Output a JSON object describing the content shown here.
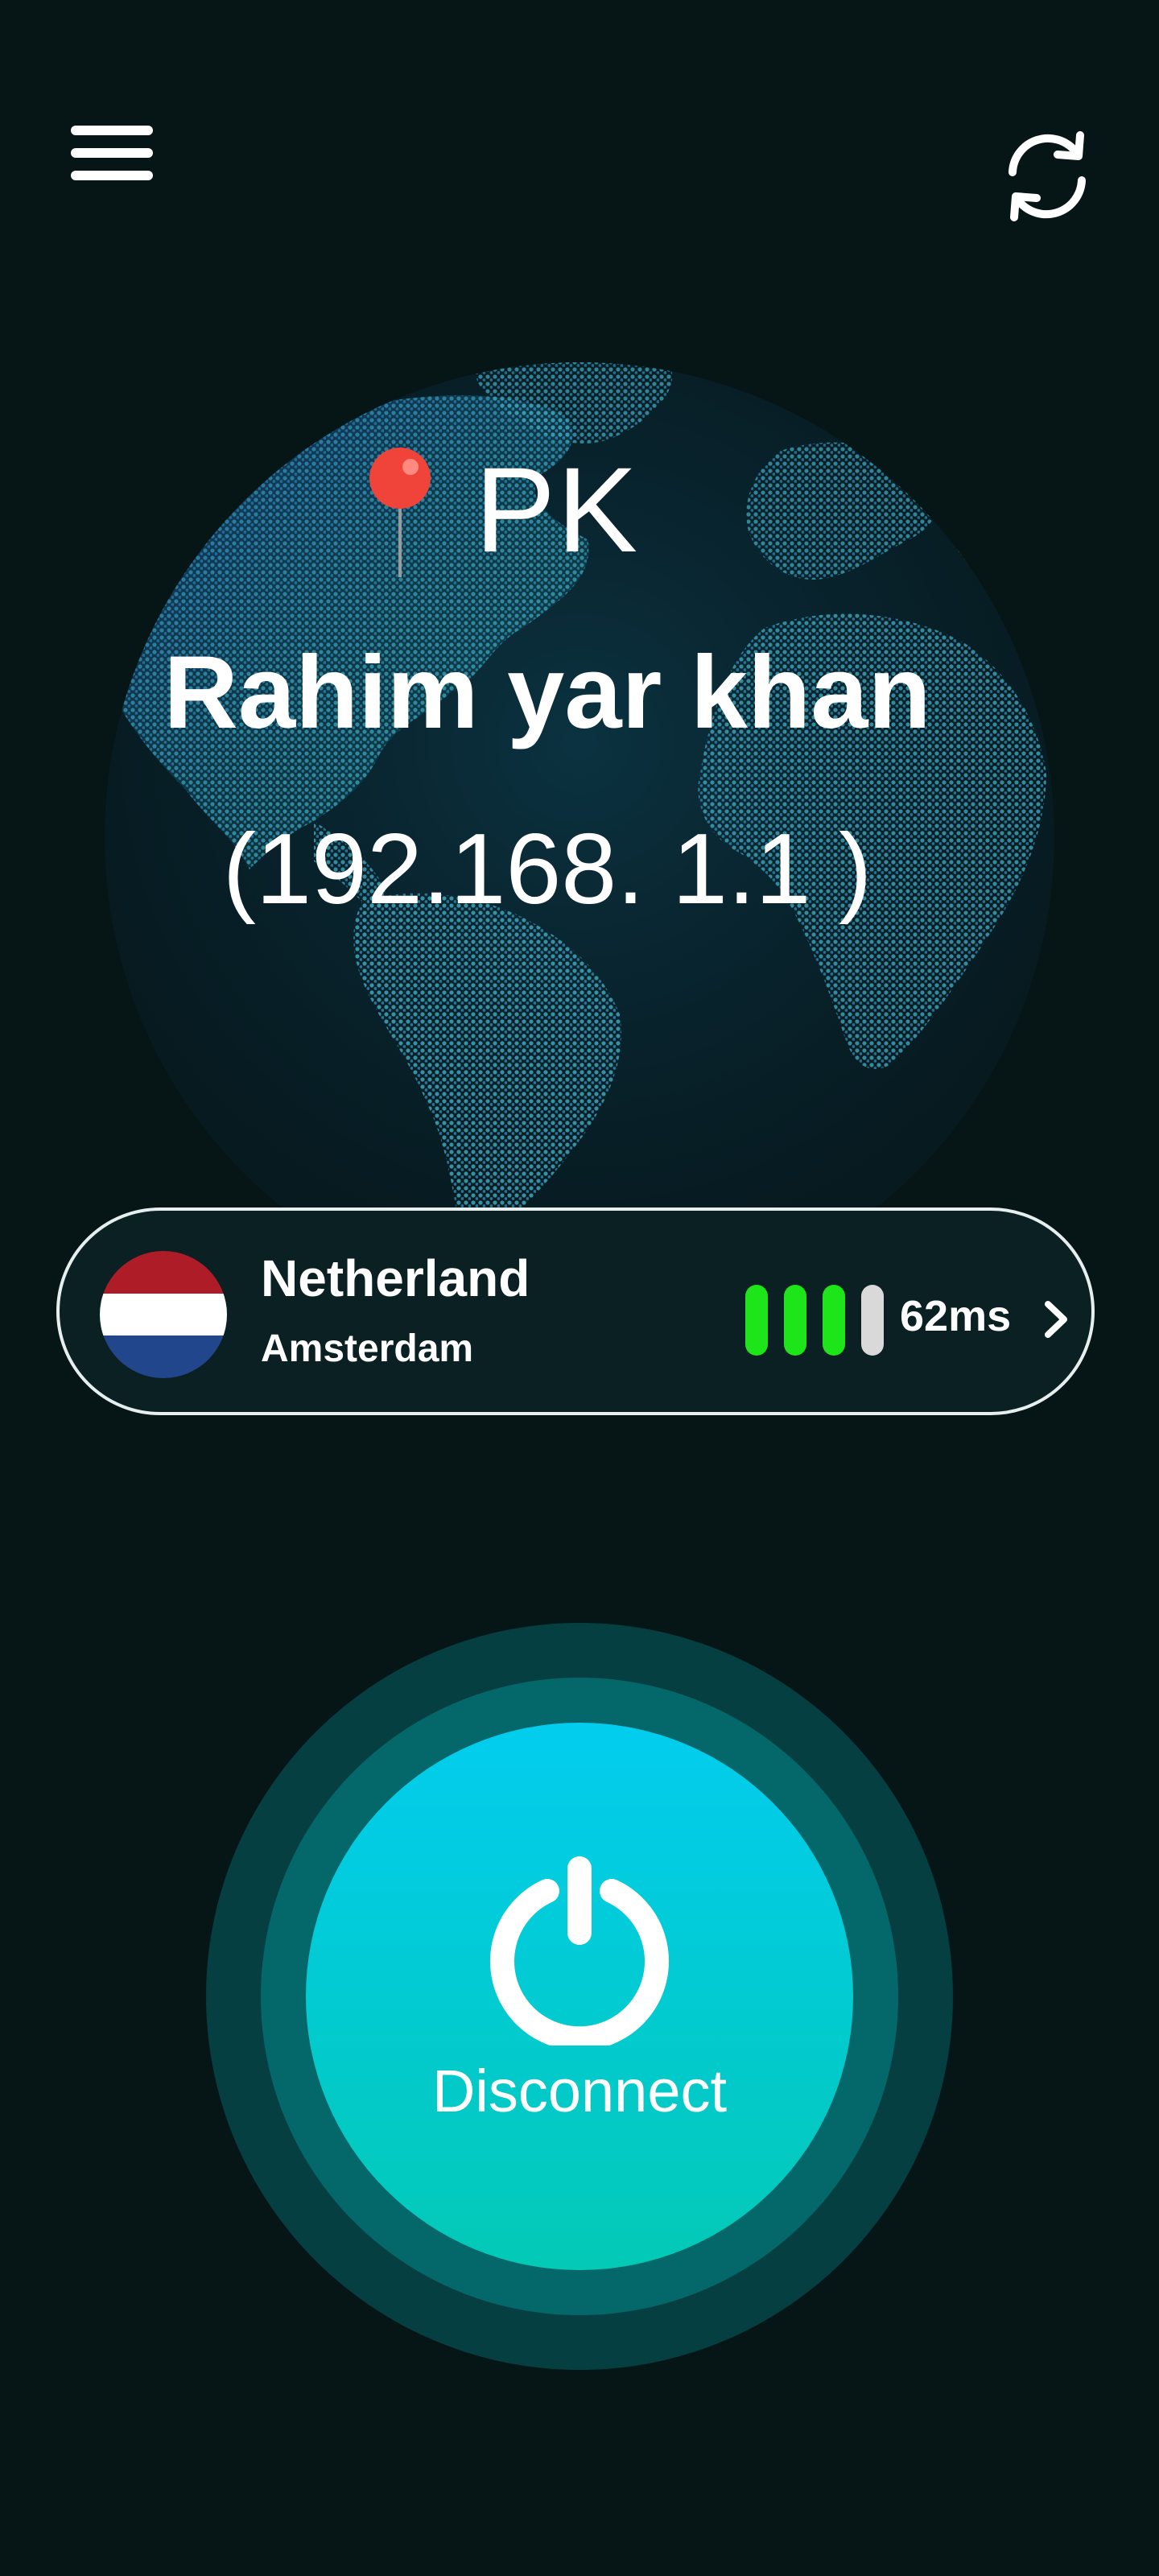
{
  "header": {
    "menu_icon": "hamburger-menu-icon",
    "refresh_icon": "refresh-icon"
  },
  "location": {
    "country_code": "PK",
    "city": "Rahim yar khan",
    "ip": "(192.168. 1.1 )",
    "pin_icon": "map-pin-icon"
  },
  "server": {
    "name": "Netherland",
    "city": "Amsterdam",
    "flag_icon": "netherlands-flag-icon",
    "signal_bars_active": 3,
    "signal_bars_total": 4,
    "ping": "62ms",
    "chevron_icon": "chevron-right-icon"
  },
  "connect": {
    "label": "Disconnect",
    "icon": "power-icon"
  },
  "colors": {
    "background": "#061617",
    "signal_active": "#1ee41a",
    "signal_inactive": "#d9d9d9",
    "button_top": "#02cdee",
    "button_bottom": "#03c9b6",
    "flag_red": "#ae1c28",
    "flag_white": "#ffffff",
    "flag_blue": "#21468b",
    "pin_red": "#f0433a"
  }
}
